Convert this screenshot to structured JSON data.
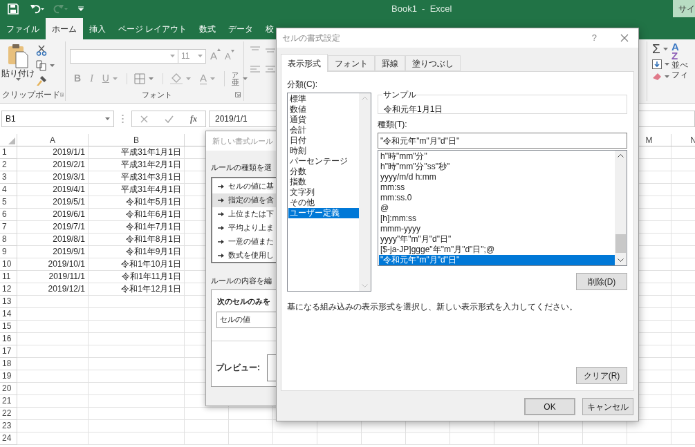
{
  "window": {
    "title": "Book1  -  Excel",
    "account_button": "サイ"
  },
  "ribbon_tabs": [
    {
      "label": "ファイル",
      "selected": false
    },
    {
      "label": "ホーム",
      "selected": true
    },
    {
      "label": "挿入",
      "selected": false
    },
    {
      "label": "ページ レイアウト",
      "selected": false
    },
    {
      "label": "数式",
      "selected": false
    },
    {
      "label": "データ",
      "selected": false
    },
    {
      "label": "校",
      "selected": false
    }
  ],
  "ribbon": {
    "clipboard": {
      "paste_label": "貼り付け",
      "group_label": "クリップボード"
    },
    "font": {
      "font_size": "11",
      "grow_label": "A",
      "shrink_label": "A",
      "bold": "B",
      "italic": "I",
      "underline": "U",
      "font_color": "A",
      "phonetic_top": "ア",
      "phonetic_bottom": "亜",
      "group_label": "フォント"
    },
    "editing": {
      "sum_button": "Σ",
      "sort_letters": [
        "A",
        "Z"
      ],
      "sort_label": "並べ",
      "filter_label": "フィ"
    }
  },
  "formula_bar": {
    "name_box": "B1",
    "function_button": "fx",
    "formula": "2019/1/1"
  },
  "sheet": {
    "columns": [
      {
        "label": "A"
      },
      {
        "label": "B"
      },
      {
        "label": "M"
      },
      {
        "label": "N"
      }
    ],
    "rows": [
      {
        "number": "1",
        "cells": [
          "2019/1/1",
          "平成31年1月1日"
        ]
      },
      {
        "number": "2",
        "cells": [
          "2019/2/1",
          "平成31年2月1日"
        ]
      },
      {
        "number": "3",
        "cells": [
          "2019/3/1",
          "平成31年3月1日"
        ]
      },
      {
        "number": "4",
        "cells": [
          "2019/4/1",
          "平成31年4月1日"
        ]
      },
      {
        "number": "5",
        "cells": [
          "2019/5/1",
          "令和1年5月1日"
        ]
      },
      {
        "number": "6",
        "cells": [
          "2019/6/1",
          "令和1年6月1日"
        ]
      },
      {
        "number": "7",
        "cells": [
          "2019/7/1",
          "令和1年7月1日"
        ]
      },
      {
        "number": "8",
        "cells": [
          "2019/8/1",
          "令和1年8月1日"
        ]
      },
      {
        "number": "9",
        "cells": [
          "2019/9/1",
          "令和1年9月1日"
        ]
      },
      {
        "number": "10",
        "cells": [
          "2019/10/1",
          "令和1年10月1日"
        ]
      },
      {
        "number": "11",
        "cells": [
          "2019/11/1",
          "令和1年11月1日"
        ]
      },
      {
        "number": "12",
        "cells": [
          "2019/12/1",
          "令和1年12月1日"
        ]
      },
      {
        "number": "13"
      },
      {
        "number": "14"
      },
      {
        "number": "15"
      },
      {
        "number": "16"
      },
      {
        "number": "17"
      },
      {
        "number": "18"
      },
      {
        "number": "19"
      },
      {
        "number": "20"
      },
      {
        "number": "21"
      },
      {
        "number": "22"
      },
      {
        "number": "23"
      },
      {
        "number": "24"
      }
    ]
  },
  "rule_dialog": {
    "title": "新しい書式ルール",
    "type_heading": "ルールの種類を選",
    "rule_types": [
      {
        "label": "セルの値に基",
        "selected": false
      },
      {
        "label": "指定の値を含",
        "selected": true
      },
      {
        "label": "上位または下",
        "selected": false
      },
      {
        "label": "平均より上ま",
        "selected": false
      },
      {
        "label": "一意の値また",
        "selected": false
      },
      {
        "label": "数式を使用し",
        "selected": false
      }
    ],
    "edit_heading": "ルールの内容を編",
    "condition_heading": "次のセルのみを",
    "condition_field": "セルの値",
    "preview_label": "プレビュー:"
  },
  "format_dialog": {
    "title": "セルの書式設定",
    "help": "?",
    "tabs": [
      {
        "label": "表示形式",
        "selected": true
      },
      {
        "label": "フォント",
        "selected": false
      },
      {
        "label": "罫線",
        "selected": false
      },
      {
        "label": "塗りつぶし",
        "selected": false
      }
    ],
    "category_label": "分類(C):",
    "categories": [
      {
        "label": "標準",
        "selected": false
      },
      {
        "label": "数値",
        "selected": false
      },
      {
        "label": "通貨",
        "selected": false
      },
      {
        "label": "会計",
        "selected": false
      },
      {
        "label": "日付",
        "selected": false
      },
      {
        "label": "時刻",
        "selected": false
      },
      {
        "label": "パーセンテージ",
        "selected": false
      },
      {
        "label": "分数",
        "selected": false
      },
      {
        "label": "指数",
        "selected": false
      },
      {
        "label": "文字列",
        "selected": false
      },
      {
        "label": "その他",
        "selected": false
      },
      {
        "label": "ユーザー定義",
        "selected": true
      }
    ],
    "sample_label": "サンプル",
    "sample_value": "令和元年1月1日",
    "type_label": "種類(T):",
    "type_value": "\"令和元年\"m\"月\"d\"日\"",
    "formats": [
      {
        "label": "h\"時\"mm\"分\"",
        "selected": false
      },
      {
        "label": "h\"時\"mm\"分\"ss\"秒\"",
        "selected": false
      },
      {
        "label": "yyyy/m/d h:mm",
        "selected": false
      },
      {
        "label": "mm:ss",
        "selected": false
      },
      {
        "label": "mm:ss.0",
        "selected": false
      },
      {
        "label": "@",
        "selected": false
      },
      {
        "label": "[h]:mm:ss",
        "selected": false
      },
      {
        "label": "mmm-yyyy",
        "selected": false
      },
      {
        "label": "yyyy\"年\"m\"月\"d\"日\"",
        "selected": false
      },
      {
        "label": "[$-ja-JP]ggge\"年\"m\"月\"d\"日\";@",
        "selected": false
      },
      {
        "label": "\"令和元年\"m\"月\"d\"日\"",
        "selected": true
      }
    ],
    "delete_button": "削除(D)",
    "description": "基になる組み込みの表示形式を選択し、新しい表示形式を入力してください。",
    "clear_button": "クリア(R)",
    "ok_button": "OK",
    "cancel_button": "キャンセル"
  }
}
